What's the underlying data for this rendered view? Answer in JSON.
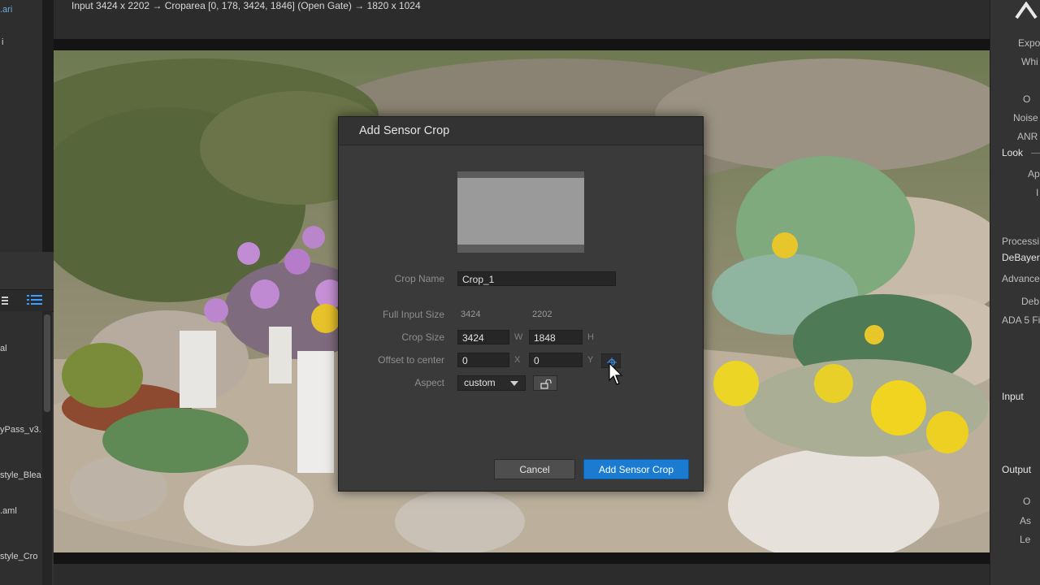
{
  "top_bar": {
    "info": "Input 3424 x 2202 → Croparea [0, 178, 3424, 1846] (Open Gate) → 1820 x 1024"
  },
  "left_panel": {
    "top_items": [
      ".ari",
      "i"
    ],
    "list_items": [
      "al",
      "yPass_v3.",
      "style_Blea",
      ".aml",
      "style_Cro"
    ]
  },
  "right_panel": {
    "items": [
      "Expo",
      "Whi",
      "O",
      "Noise",
      "ANR",
      "Look",
      "Ap",
      "I",
      "Processi",
      "DeBayer",
      "Advance",
      "Deb",
      "ADA 5 Fi",
      "Input",
      "Output",
      "O",
      "As",
      "Le"
    ]
  },
  "dialog": {
    "title": "Add Sensor Crop",
    "crop_name_label": "Crop Name",
    "crop_name_value": "Crop_1",
    "full_input_label": "Full Input Size",
    "full_input_w": "3424",
    "full_input_h": "2202",
    "crop_size_label": "Crop Size",
    "crop_w": "3424",
    "crop_h": "1848",
    "w_axis": "W",
    "h_axis": "H",
    "offset_label": "Offset to center",
    "offset_x": "0",
    "offset_y": "0",
    "x_axis": "X",
    "y_axis": "Y",
    "aspect_label": "Aspect",
    "aspect_value": "custom",
    "cancel_label": "Cancel",
    "add_label": "Add Sensor Crop"
  },
  "colors": {
    "accent": "#1a7bd0",
    "dialog_bg": "#3a3a3a",
    "panel_bg": "#333333"
  },
  "icons": [
    "list-view-icon",
    "menu-icon",
    "center-crosshair-icon",
    "lock-icon",
    "caret-down-icon",
    "mouse-cursor-icon",
    "panel-logo-icon"
  ]
}
